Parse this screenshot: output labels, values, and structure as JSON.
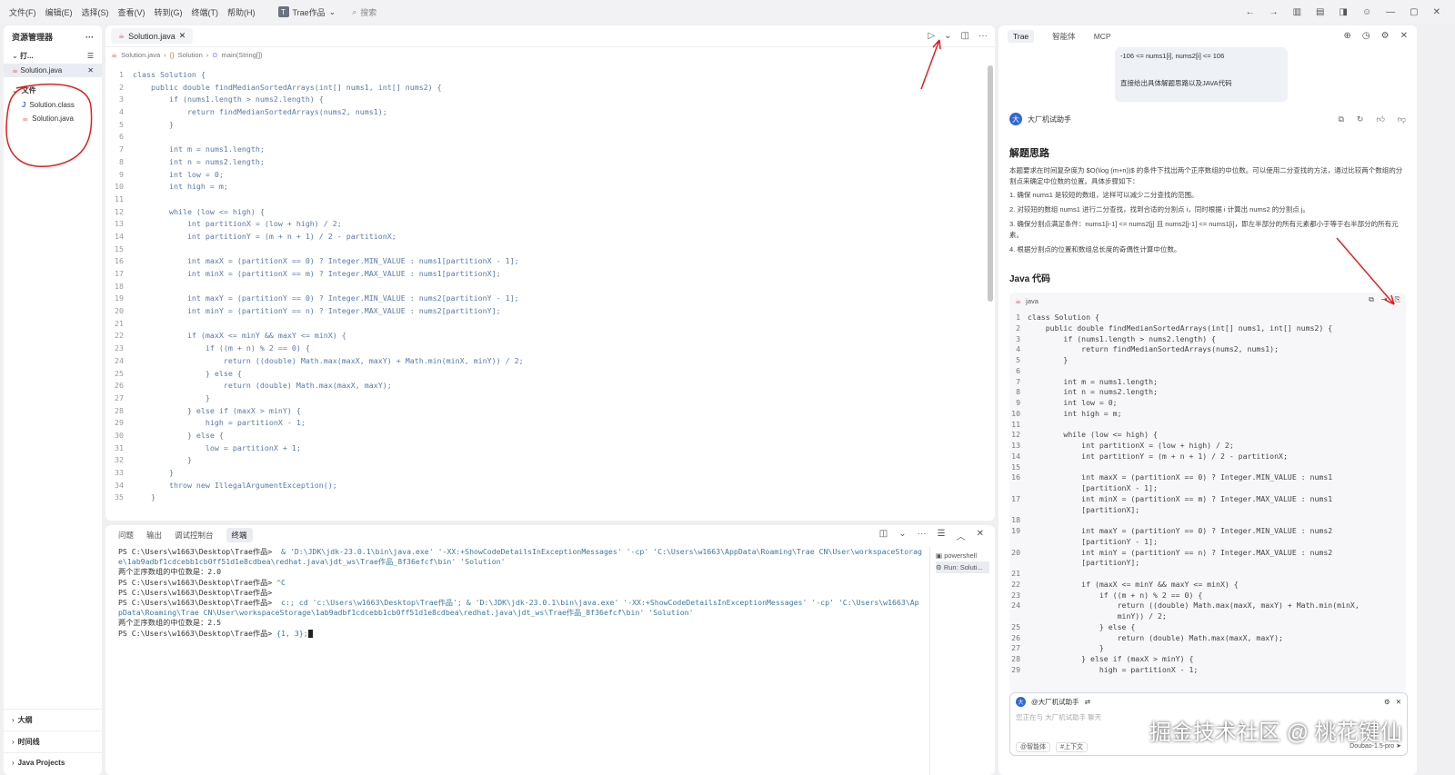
{
  "menu": [
    "文件(F)",
    "编辑(E)",
    "选择(S)",
    "查看(V)",
    "转到(G)",
    "终端(T)",
    "帮助(H)"
  ],
  "workspace": {
    "logo": "T",
    "name": "Trae作品"
  },
  "search_placeholder": "搜索",
  "sidebar": {
    "title": "资源管理器",
    "open_editors": "打...",
    "open_file": "Solution.java",
    "folder": "文件",
    "files": [
      {
        "name": "Solution.class",
        "icon": "class-file-icon"
      },
      {
        "name": "Solution.java",
        "icon": "java-file-icon"
      }
    ],
    "bottom": [
      "大纲",
      "时间线",
      "Java Projects"
    ]
  },
  "editor": {
    "tab": "Solution.java",
    "breadcrumb": [
      "Solution.java",
      "Solution",
      "main(String[])"
    ],
    "lines": [
      "class Solution {",
      "    public double findMedianSortedArrays(int[] nums1, int[] nums2) {",
      "        if (nums1.length > nums2.length) {",
      "            return findMedianSortedArrays(nums2, nums1);",
      "        }",
      "",
      "        int m = nums1.length;",
      "        int n = nums2.length;",
      "        int low = 0;",
      "        int high = m;",
      "",
      "        while (low <= high) {",
      "            int partitionX = (low + high) / 2;",
      "            int partitionY = (m + n + 1) / 2 - partitionX;",
      "",
      "            int maxX = (partitionX == 0) ? Integer.MIN_VALUE : nums1[partitionX - 1];",
      "            int minX = (partitionX == m) ? Integer.MAX_VALUE : nums1[partitionX];",
      "",
      "            int maxY = (partitionY == 0) ? Integer.MIN_VALUE : nums2[partitionY - 1];",
      "            int minY = (partitionY == n) ? Integer.MAX_VALUE : nums2[partitionY];",
      "",
      "            if (maxX <= minY && maxY <= minX) {",
      "                if ((m + n) % 2 == 0) {",
      "                    return ((double) Math.max(maxX, maxY) + Math.min(minX, minY)) / 2;",
      "                } else {",
      "                    return (double) Math.max(maxX, maxY);",
      "                }",
      "            } else if (maxX > minY) {",
      "                high = partitionX - 1;",
      "            } else {",
      "                low = partitionX + 1;",
      "            }",
      "        }",
      "        throw new IllegalArgumentException();",
      "    }"
    ]
  },
  "panel": {
    "tabs": [
      "问题",
      "输出",
      "调试控制台",
      "终端"
    ],
    "terminal": [
      {
        "p": "PS C:\\Users\\w1663\\Desktop\\Trae作品> ",
        "c": " & 'D:\\JDK\\jdk-23.0.1\\bin\\java.exe' '-XX:+ShowCodeDetailsInExceptionMessages' '-cp' 'C:\\Users\\w1663\\AppData\\Roaming\\Trae CN\\User\\workspaceStorage\\1ab9adbf1cdcebb1cb0ff51d1e8cdbea\\redhat.java\\jdt_ws\\Trae作品_8f36efcf\\bin' 'Solution'"
      },
      {
        "p": "两个正序数组的中位数是：2.0",
        "c": ""
      },
      {
        "p": "PS C:\\Users\\w1663\\Desktop\\Trae作品> ",
        "c": "^C"
      },
      {
        "p": "PS C:\\Users\\w1663\\Desktop\\Trae作品> ",
        "c": ""
      },
      {
        "p": "PS C:\\Users\\w1663\\Desktop\\Trae作品> ",
        "c": " c:; cd 'c:\\Users\\w1663\\Desktop\\Trae作品'; & 'D:\\JDK\\jdk-23.0.1\\bin\\java.exe' '-XX:+ShowCodeDetailsInExceptionMessages' '-cp' 'C:\\Users\\w1663\\AppData\\Roaming\\Trae CN\\User\\workspaceStorage\\1ab9adbf1cdcebb1cb0ff51d1e8cdbea\\redhat.java\\jdt_ws\\Trae作品_8f36efcf\\bin' 'Solution'"
      },
      {
        "p": "两个正序数组的中位数是：2.5",
        "c": ""
      },
      {
        "p": "PS C:\\Users\\w1663\\Desktop\\Trae作品> ",
        "c": "{1, 3};"
      }
    ],
    "terminal_list": [
      "powershell",
      "Run: Soluti..."
    ]
  },
  "chat": {
    "tabs": [
      "Trae",
      "智能体",
      "MCP"
    ],
    "user_msg": [
      "-106 <= nums1[i], nums2[i] <= 106",
      "",
      "直接给出具体解题思路以及JAVA代码"
    ],
    "assistant": "大厂机试助手",
    "title": "解题思路",
    "intro": "本题要求在时间复杂度为 $O(\\log (m+n))$ 的条件下找出两个正序数组的中位数。可以使用二分查找的方法，通过比较两个数组的分割点来确定中位数的位置。具体步骤如下：",
    "steps": [
      "1. 确保 nums1 是较短的数组，这样可以减少二分查找的范围。",
      "2. 对较短的数组 nums1 进行二分查找，找到合适的分割点 i，同时根据 i 计算出 nums2 的分割点 j。",
      "3. 确保分割点满足条件：nums1[i-1] <= nums2[j] 且 nums2[j-1] <= nums1[i]，即左半部分的所有元素都小于等于右半部分的所有元素。",
      "4. 根据分割点的位置和数组总长度的奇偶性计算中位数。"
    ],
    "code_title": "Java 代码",
    "code_lang": "java",
    "code": [
      [
        "1",
        "class Solution {"
      ],
      [
        "2",
        "    public double findMedianSortedArrays(int[] nums1, int[] nums2) {"
      ],
      [
        "3",
        "        if (nums1.length > nums2.length) {"
      ],
      [
        "4",
        "            return findMedianSortedArrays(nums2, nums1);"
      ],
      [
        "5",
        "        }"
      ],
      [
        "6",
        ""
      ],
      [
        "7",
        "        int m = nums1.length;"
      ],
      [
        "8",
        "        int n = nums2.length;"
      ],
      [
        "9",
        "        int low = 0;"
      ],
      [
        "10",
        "        int high = m;"
      ],
      [
        "11",
        ""
      ],
      [
        "12",
        "        while (low <= high) {"
      ],
      [
        "13",
        "            int partitionX = (low + high) / 2;"
      ],
      [
        "14",
        "            int partitionY = (m + n + 1) / 2 - partitionX;"
      ],
      [
        "15",
        ""
      ],
      [
        "16",
        "            int maxX = (partitionX == 0) ? Integer.MIN_VALUE : nums1"
      ],
      [
        "",
        "            [partitionX - 1];"
      ],
      [
        "17",
        "            int minX = (partitionX == m) ? Integer.MAX_VALUE : nums1"
      ],
      [
        "",
        "            [partitionX];"
      ],
      [
        "18",
        ""
      ],
      [
        "19",
        "            int maxY = (partitionY == 0) ? Integer.MIN_VALUE : nums2"
      ],
      [
        "",
        "            [partitionY - 1];"
      ],
      [
        "20",
        "            int minY = (partitionY == n) ? Integer.MAX_VALUE : nums2"
      ],
      [
        "",
        "            [partitionY];"
      ],
      [
        "21",
        ""
      ],
      [
        "22",
        "            if (maxX <= minY && maxY <= minX) {"
      ],
      [
        "23",
        "                if ((m + n) % 2 == 0) {"
      ],
      [
        "24",
        "                    return ((double) Math.max(maxX, maxY) + Math.min(minX,"
      ],
      [
        "",
        "                    minY)) / 2;"
      ],
      [
        "25",
        "                } else {"
      ],
      [
        "26",
        "                    return (double) Math.max(maxX, maxY);"
      ],
      [
        "27",
        "                }"
      ],
      [
        "28",
        "            } else if (maxX > minY) {"
      ],
      [
        "29",
        "                high = partitionX - 1;"
      ]
    ],
    "input": {
      "agent": "@大厂机试助手",
      "placeholder": "您正在与 大厂机试助手 聊天",
      "chip_agent": "@智能体",
      "chip_ctx": "#上下文",
      "model": "Doubao-1.5-pro"
    }
  },
  "watermark": "掘金技术社区 @ 桃花键仙",
  "colors": {
    "annotation": "#e02020",
    "accent": "#3066d8"
  }
}
